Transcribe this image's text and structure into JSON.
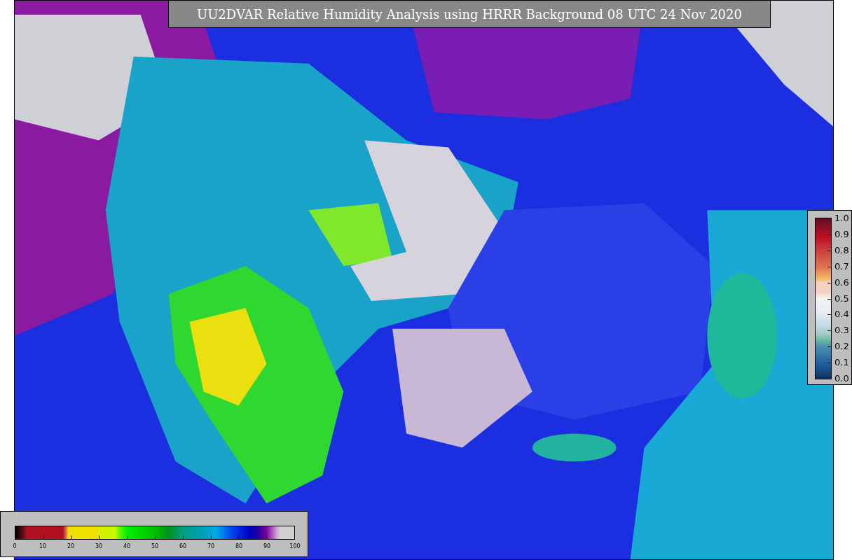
{
  "title": "UU2DVAR Relative Humidity Analysis using HRRR Background 08 UTC 24 Nov 2020",
  "humidity_colorbar": {
    "ticks": [
      "0",
      "10",
      "20",
      "30",
      "40",
      "50",
      "60",
      "70",
      "80",
      "90",
      "100"
    ]
  },
  "station_colorbar": {
    "ticks": [
      "1.0",
      "0.9",
      "0.8",
      "0.7",
      "0.6",
      "0.5",
      "0.4",
      "0.3",
      "0.2",
      "0.1",
      "0.0"
    ]
  }
}
